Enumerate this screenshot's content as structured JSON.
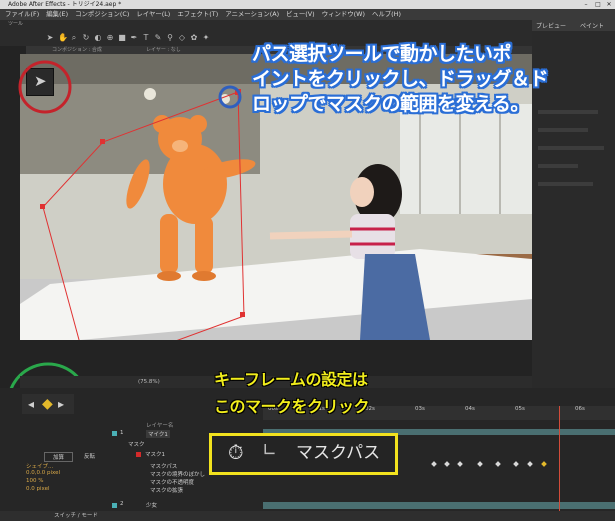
{
  "window": {
    "title": "Adobe After Effects - トリジイ24.aep *"
  },
  "menu": [
    "ファイル(F)",
    "編集(E)",
    "コンポジション(C)",
    "レイヤー(L)",
    "エフェクト(T)",
    "アニメーション(A)",
    "ビュー(V)",
    "ウィンドウ(W)",
    "ヘルプ(H)"
  ],
  "toolbar": {
    "label": "ツール"
  },
  "panel": {
    "comp_tab": "コンポジション : 合成",
    "layer_tab": "レイヤー : なし"
  },
  "right_panel": {
    "tab1": "プレビュー",
    "tab2": "ペイント"
  },
  "timeline": {
    "ticks": [
      "00s",
      "01s",
      "02s",
      "03s",
      "04s",
      "05s",
      "06s"
    ],
    "layer_header": "レイヤー名",
    "layer1": {
      "index": "1",
      "name": "マイク1"
    },
    "mask_group": "マスク",
    "mask": {
      "name": "マスク1",
      "mode": "加算",
      "invert": "反転"
    },
    "props": [
      {
        "label": "マスクパス",
        "value": "シェイプ..."
      },
      {
        "label": "マスクの境界のぼかし",
        "value": "0.0,0.0 pixel"
      },
      {
        "label": "マスクの不透明度",
        "value": "100 %"
      },
      {
        "label": "マスクの拡張",
        "value": "0.0 pixel"
      }
    ],
    "layer2": {
      "index": "2",
      "name": "少女"
    },
    "footer": "スイッチ / モード",
    "zoom_label": "マスクパス",
    "viewer_zoom": "(75.8%)"
  },
  "callouts": {
    "path_tool": [
      "パス選択ツールで動かしたいポ",
      "イントをクリックし、ドラッグ＆ド",
      "ロップでマスクの範囲を変える。"
    ],
    "keyframe": [
      "キーフレームの設定は",
      "このマークをクリック"
    ]
  },
  "colors": {
    "callout_outline": "#2a6ed6",
    "keyframe_text": "#f2ee1c",
    "red_circle": "#c4232b",
    "green_circle": "#2aa84b",
    "blue_circle": "#2f5fbf"
  }
}
